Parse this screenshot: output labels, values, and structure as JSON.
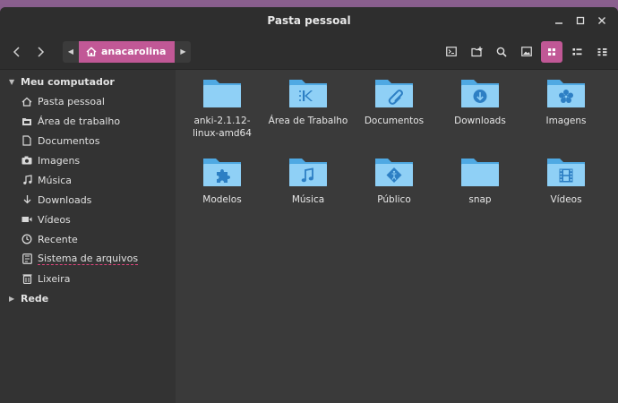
{
  "window": {
    "title": "Pasta pessoal",
    "controls": [
      "minimize",
      "maximize",
      "close"
    ]
  },
  "toolbar": {
    "back_icon": "chevron-left-icon",
    "forward_icon": "chevron-right-icon",
    "crumb_label": "anacarolina",
    "crumb_icon": "home-icon",
    "actions": [
      "terminal-icon",
      "new-folder-icon",
      "search-icon",
      "image-icon",
      "icon-view-icon",
      "compact-list-icon",
      "detail-list-icon"
    ],
    "active_view": "icon-view",
    "accent": "#c15896"
  },
  "sidebar": {
    "computer_header": "Meu computador",
    "items": [
      {
        "label": "Pasta pessoal",
        "icon": "home-icon"
      },
      {
        "label": "Área de trabalho",
        "icon": "desktop-icon"
      },
      {
        "label": "Documentos",
        "icon": "document-icon"
      },
      {
        "label": "Imagens",
        "icon": "camera-icon"
      },
      {
        "label": "Música",
        "icon": "music-icon"
      },
      {
        "label": "Downloads",
        "icon": "download-icon"
      },
      {
        "label": "Vídeos",
        "icon": "video-icon"
      },
      {
        "label": "Recente",
        "icon": "clock-icon"
      },
      {
        "label": "Sistema de arquivos",
        "icon": "filesystem-icon"
      },
      {
        "label": "Lixeira",
        "icon": "trash-icon"
      }
    ],
    "network_header": "Rede"
  },
  "files": [
    {
      "name": "anki-2.1.12-linux-amd64",
      "emblem": "none"
    },
    {
      "name": "Área de Trabalho",
      "emblem": "kde"
    },
    {
      "name": "Documentos",
      "emblem": "paperclip"
    },
    {
      "name": "Downloads",
      "emblem": "download"
    },
    {
      "name": "Imagens",
      "emblem": "flower"
    },
    {
      "name": "Modelos",
      "emblem": "puzzle"
    },
    {
      "name": "Música",
      "emblem": "music"
    },
    {
      "name": "Público",
      "emblem": "share"
    },
    {
      "name": "snap",
      "emblem": "none"
    },
    {
      "name": "Vídeos",
      "emblem": "film"
    }
  ],
  "colors": {
    "folder_light": "#8fd0f6",
    "folder_dark": "#4fa9e3",
    "emblem": "#2d7fc4"
  }
}
